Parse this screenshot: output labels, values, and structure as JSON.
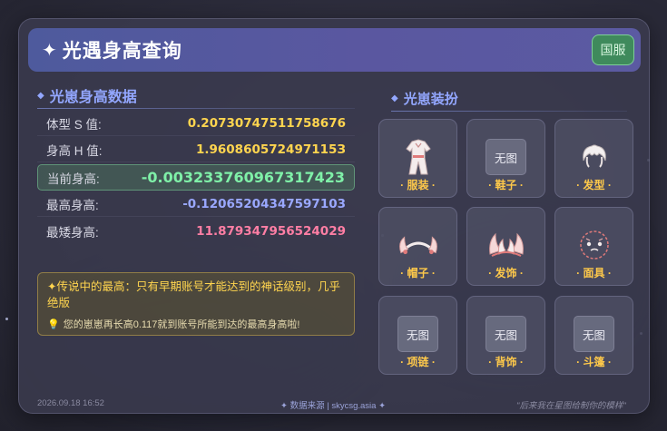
{
  "header": {
    "title": "光遇身高查询",
    "region_button": "国服"
  },
  "stats": {
    "section_title": "光崽身高数据",
    "rows": [
      {
        "label": "体型 S 值:",
        "value": "0.20730747511758676",
        "color": "#ffd54f"
      },
      {
        "label": "身高 H 值:",
        "value": "1.960860572497115З",
        "color": "#ffd54f"
      },
      {
        "label": "当前身高:",
        "value": "-0.003233760967317423",
        "color": "#7ff0a8"
      },
      {
        "label": "最高身高:",
        "value": "-0.12065204347597103",
        "color": "#9aa8ff"
      },
      {
        "label": "最矮身高:",
        "value": "11.879347956524029",
        "color": "#ff7ea4"
      }
    ]
  },
  "notice": {
    "line1": "✦传说中的最高：只有早期账号才能达到的神话级别，几乎绝版",
    "line2": "您的崽崽再长高0.117就到账号所能到达的最高身高啦!"
  },
  "outfit": {
    "section_title": "光崽装扮",
    "no_image_text": "无图",
    "items": [
      {
        "label": "· 服装 ·",
        "icon": "outfit-icon",
        "has_image": true
      },
      {
        "label": "· 鞋子 ·",
        "icon": "shoes-icon",
        "has_image": false
      },
      {
        "label": "· 发型 ·",
        "icon": "hairstyle-icon",
        "has_image": true
      },
      {
        "label": "· 帽子 ·",
        "icon": "hat-icon",
        "has_image": true
      },
      {
        "label": "· 发饰 ·",
        "icon": "hair-accessory-icon",
        "has_image": true
      },
      {
        "label": "· 面具 ·",
        "icon": "mask-icon",
        "has_image": true
      },
      {
        "label": "· 项链 ·",
        "icon": "necklace-icon",
        "has_image": false
      },
      {
        "label": "· 背饰 ·",
        "icon": "back-accessory-icon",
        "has_image": false
      },
      {
        "label": "· 斗篷 ·",
        "icon": "cape-icon",
        "has_image": false
      }
    ]
  },
  "footer": {
    "timestamp": "2026.09.18 16:52",
    "source": "✦ 数据来源 | skycsg.asia ✦",
    "quote": "\"后来我在星图给制你的模样\""
  },
  "colors": {
    "header_start": "#4e5a9d",
    "header_end": "#5b5aa2",
    "accent": "#93a7ff",
    "caption": "#ffc94a",
    "region_button": "#3f8a5c"
  }
}
